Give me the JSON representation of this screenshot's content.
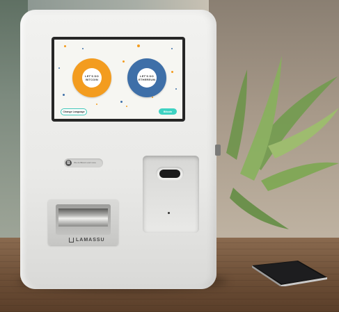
{
  "screen": {
    "bitcoin_button": "LET'S DO BITCOIN",
    "ethereum_button": "LET'S DO ETHEREUM",
    "change_language": "Change Language",
    "next_button": "Bitcoin"
  },
  "badge": {
    "icon": "B",
    "text": "We do Bitcoin and more"
  },
  "brand": {
    "name": "LAMASSU"
  },
  "colors": {
    "bitcoin": "#f39c1f",
    "ethereum": "#3e6fa8",
    "accent": "#3ed2c2"
  }
}
